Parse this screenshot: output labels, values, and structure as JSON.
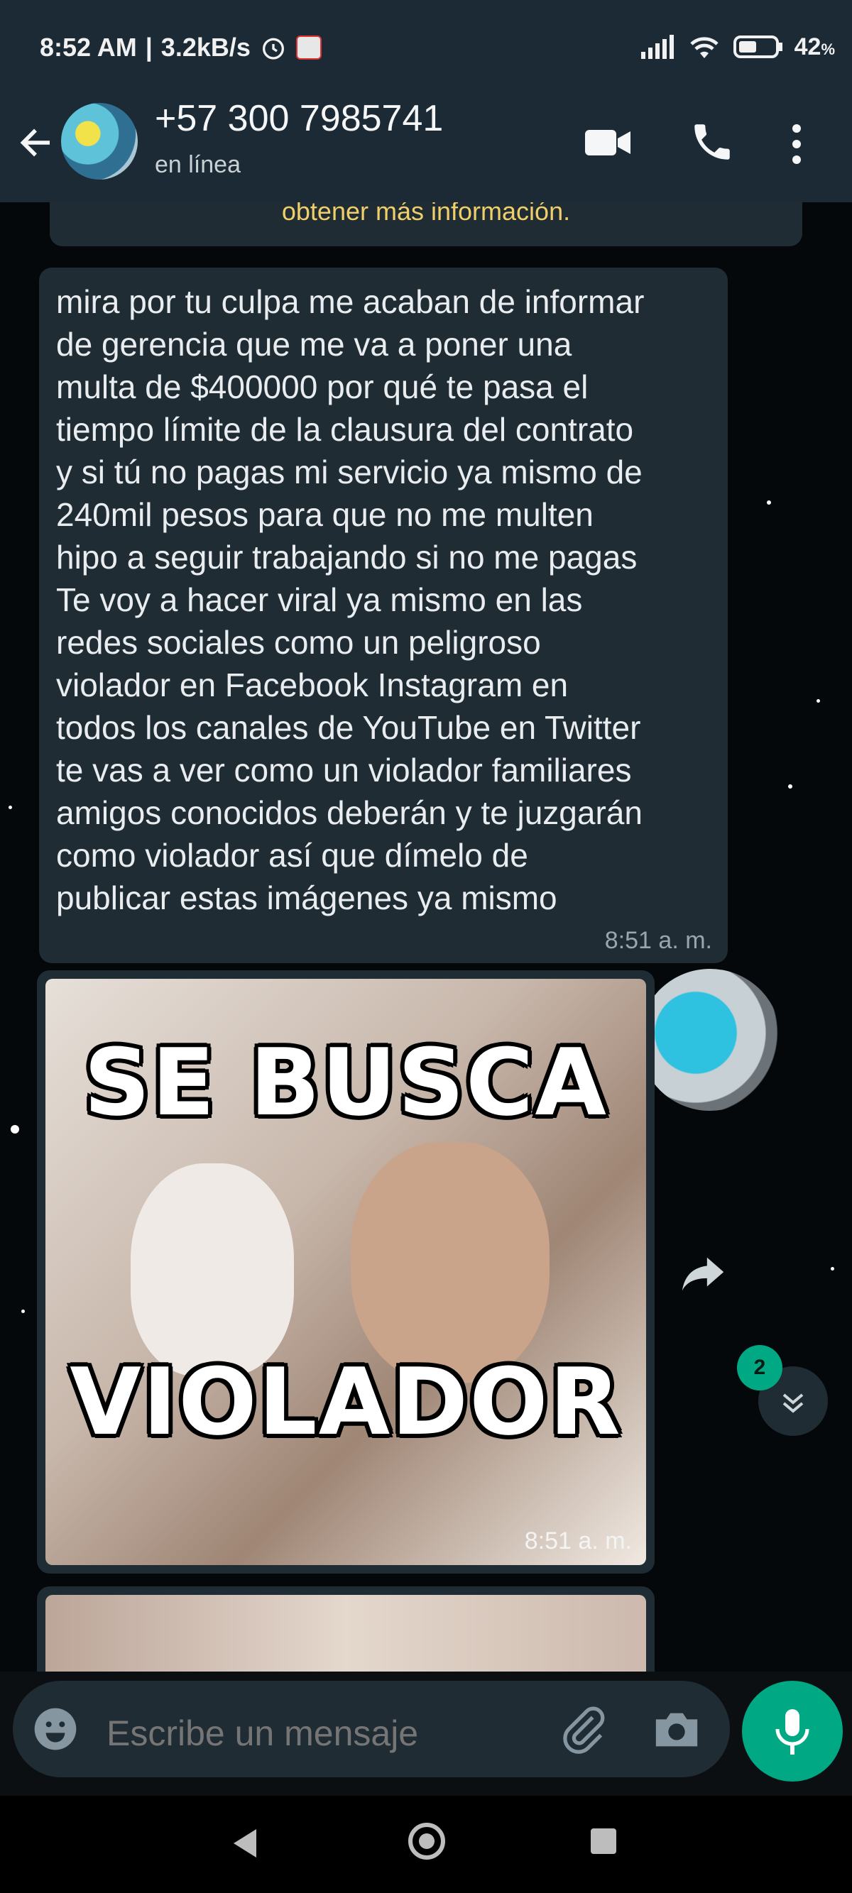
{
  "status_bar": {
    "time": "8:52 AM",
    "speed": "3.2kB/s",
    "battery": "42"
  },
  "header": {
    "contact": "+57 300 7985741",
    "status": "en línea"
  },
  "chat": {
    "system_notice": "obtener más información.",
    "messages": [
      {
        "text": "mira por tu culpa me acaban de informar\nde gerencia que me va a poner una\nmulta de $400000 por qué te pasa el\ntiempo límite de la clausura del contrato\ny si tú no pagas mi servicio ya mismo de\n240mil pesos para que no me multen\nhipo a seguir trabajando si no me pagas\nTe voy a hacer viral ya mismo en las\nredes sociales como un peligroso\nviolador en Facebook Instagram en\ntodos los canales de YouTube en Twitter\nte vas a ver como un violador familiares\namigos conocidos deberán y te juzgarán\ncomo violador así que dímelo de\npublicar estas imágenes ya mismo",
        "time": "8:51 a. m."
      },
      {
        "image_top_text": "SE BUSCA",
        "image_bottom_text": "VIOLADOR",
        "time": "8:51 a. m."
      }
    ],
    "unread_count": "2"
  },
  "input": {
    "placeholder": "Escribe un mensaje"
  },
  "colors": {
    "header_bg": "#1b2a34",
    "bubble_bg": "#1f2c34",
    "accent": "#00a884",
    "notice_text": "#f0cf6a"
  },
  "icons": [
    "alarm-icon",
    "signal-icon",
    "wifi-icon",
    "battery-icon",
    "back-arrow-icon",
    "video-call-icon",
    "phone-icon",
    "more-vert-icon",
    "forward-icon",
    "chevron-down-double-icon",
    "emoji-icon",
    "attach-icon",
    "camera-icon",
    "mic-icon"
  ]
}
